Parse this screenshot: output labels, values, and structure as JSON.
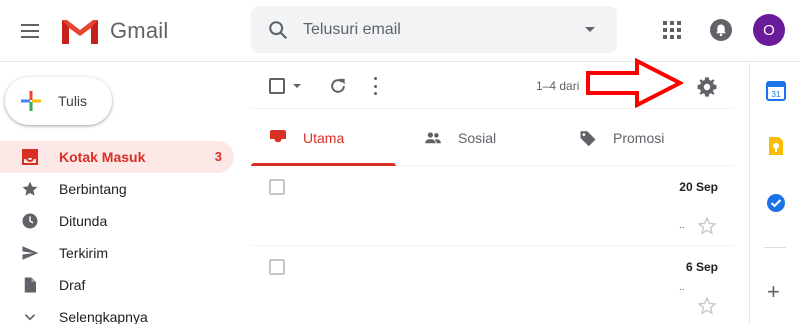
{
  "header": {
    "app_name": "Gmail",
    "search_placeholder": "Telusuri email",
    "avatar_letter": "O",
    "avatar_color": "#6a1b9a"
  },
  "sidebar": {
    "compose_label": "Tulis",
    "items": [
      {
        "label": "Kotak Masuk",
        "count": "3",
        "icon": "inbox-icon",
        "active": true
      },
      {
        "label": "Berbintang",
        "count": "",
        "icon": "star-icon"
      },
      {
        "label": "Ditunda",
        "count": "",
        "icon": "clock-icon"
      },
      {
        "label": "Terkirim",
        "count": "",
        "icon": "send-icon"
      },
      {
        "label": "Draf",
        "count": "",
        "icon": "draft-icon"
      },
      {
        "label": "Selengkapnya",
        "count": "",
        "icon": "chevron-down-icon"
      }
    ]
  },
  "toolbar": {
    "page_info": "1–4 dari"
  },
  "tabs": [
    {
      "label": "Utama",
      "icon": "inbox-icon",
      "active": true
    },
    {
      "label": "Sosial",
      "icon": "people-icon"
    },
    {
      "label": "Promosi",
      "icon": "tag-icon"
    }
  ],
  "emails": [
    {
      "date": "20 Sep",
      "snippet_dots": ".."
    },
    {
      "date": "6 Sep",
      "snippet_dots": ".."
    }
  ],
  "colors": {
    "accent_red": "#d93025",
    "active_bg": "#fce8e6",
    "annotation_arrow": "#ff0000"
  }
}
